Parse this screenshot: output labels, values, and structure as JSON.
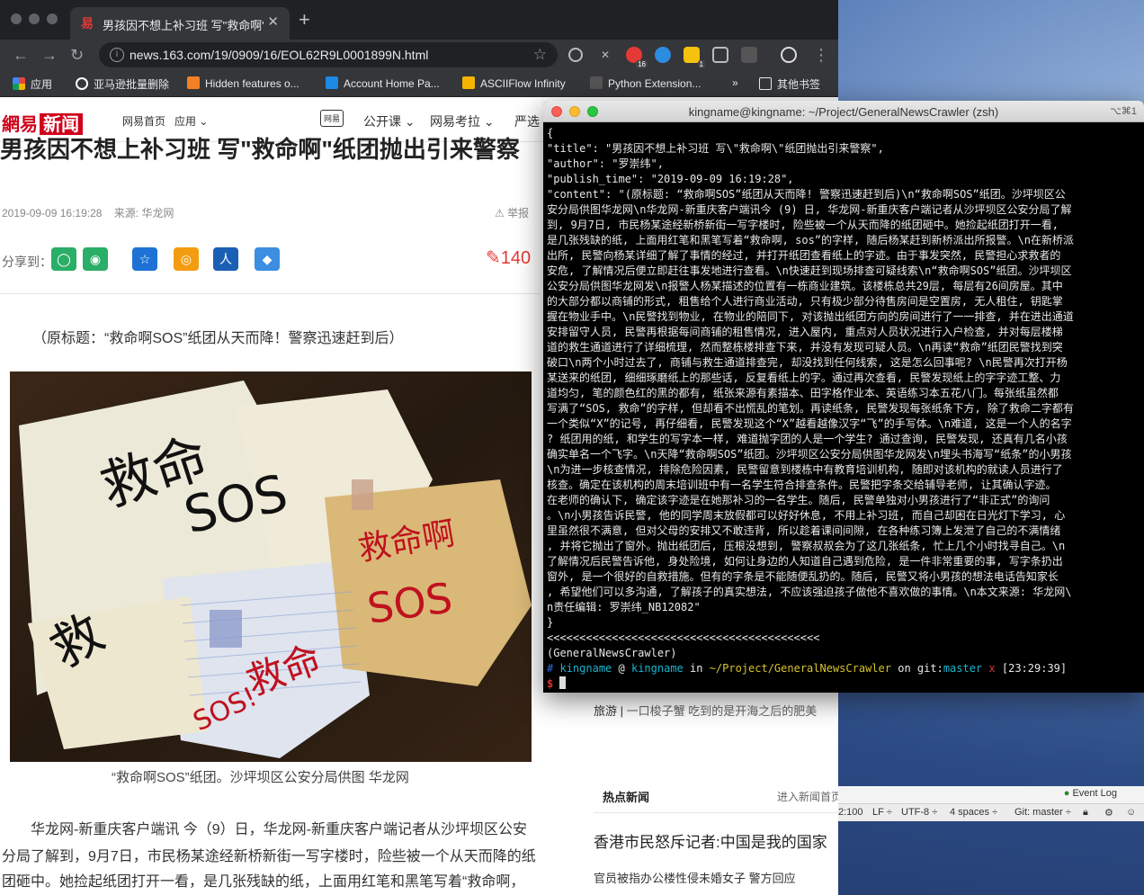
{
  "browser": {
    "tab_title": "男孩因不想上补习班 写\"救命啊\"...",
    "tab_favicon": "易",
    "url": "news.163.com/19/0909/16/EOL62R9L0001899N.html",
    "extension_badges": [
      "16",
      "1"
    ],
    "bookmarks": [
      {
        "label": "应用",
        "color": "#e8453c"
      },
      {
        "label": "亚马逊批量删除",
        "color": "#ffffff"
      },
      {
        "label": "Hidden features o...",
        "color": "#f48024"
      },
      {
        "label": "Account Home Pa...",
        "color": "#1e88e5"
      },
      {
        "label": "ASCIIFlow Infinity",
        "color": "#f4b400"
      },
      {
        "label": "Python Extension...",
        "color": "#555555"
      }
    ],
    "bookmarks_overflow": "»",
    "other_bookmarks": "其他书签"
  },
  "site": {
    "logo_text": "網易",
    "logo_box": "新闻",
    "nav_home": "网易首页",
    "nav_apps": "应用",
    "nav_open_course": "公开课",
    "nav_exam": "网易考拉",
    "nav_yanxuan": "严选",
    "nav_logo_small": "网易"
  },
  "article": {
    "headline": "男孩因不想上补习班 写\"救命啊\"纸团抛出引来警察",
    "datetime": "2019-09-09 16:19:28",
    "source": "来源: 华龙网",
    "report": "举报",
    "share_label": "分享到：",
    "comment_count": "140",
    "orig_title": "（原标题：“救命啊SOS”纸团从天而降！警察迅速赶到后）",
    "caption": "“救命啊SOS”纸团。沙坪坝区公安分局供图 华龙网",
    "body_lines": [
      "　　华龙网-新重庆客户端讯 今（9）日，华龙网-新重庆客户端记者从沙坪坝区公安",
      "分局了解到，9月7日，市民杨某途经新桥新街一写字楼时，险些被一个从天而降的纸",
      "团砸中。她捡起纸团打开一看，是几张残缺的纸，上面用红笔和黑笔写着“救命啊，"
    ]
  },
  "sidebar": {
    "travel_tag": "旅游",
    "travel_text": "一口梭子蟹 吃到的是开海之后的肥美",
    "hot_title": "热点新闻",
    "hot_more": "进入新闻首页",
    "hot_1": "香港市民怒斥记者:中国是我的国家",
    "hot_2": "官员被指办公楼性侵未婚女子 警方回应"
  },
  "editor_status": {
    "event_log": "Event Log",
    "position": "2:100",
    "line_ending": "LF ÷",
    "encoding": "UTF-8 ÷",
    "indent": "4 spaces ÷",
    "git": "Git: master ÷"
  },
  "terminal": {
    "title": "kingname@kingname: ~/Project/GeneralNewsCrawler (zsh)",
    "shortcut": "⌥⌘1",
    "output_lines": [
      "{",
      "  \"title\": \"男孩因不想上补习班 写\\\"救命啊\\\"纸团抛出引来警察\",",
      "  \"author\": \"罗崇纬\",",
      "  \"publish_time\": \"2019-09-09 16:19:28\",",
      "  \"content\": \"(原标题: “救命啊SOS”纸团从天而降! 警察迅速赶到后)\\n“救命啊SOS”纸团。沙坪坝区公",
      "安分局供图华龙网\\n华龙网-新重庆客户端讯今 (9) 日, 华龙网-新重庆客户端记者从沙坪坝区公安分局了解",
      "到, 9月7日, 市民杨某途经新桥新街一写字楼时, 险些被一个从天而降的纸团砸中。她捡起纸团打开一看,",
      "是几张残缺的纸, 上面用红笔和黑笔写着“救命啊, sos”的字样, 随后杨某赶到新桥派出所报警。\\n在新桥派",
      "出所, 民警向杨某详细了解了事情的经过, 并打开纸团查看纸上的字迹。由于事发突然, 民警担心求救者的",
      "安危, 了解情况后便立即赶往事发地进行查看。\\n快速赶到现场排查可疑线索\\n“救命啊SOS”纸团。沙坪坝区",
      "公安分局供图华龙网发\\n报警人杨某描述的位置有一栋商业建筑。该楼栋总共29层, 每层有26间房屋。其中",
      "的大部分都以商铺的形式, 租售给个人进行商业活动, 只有极少部分待售房间是空置房, 无人租住, 钥匙掌",
      "握在物业手中。\\n民警找到物业, 在物业的陪同下, 对该抛出纸团方向的房间进行了一一排查, 并在进出通道",
      "安排留守人员, 民警再根据每间商铺的租售情况, 进入屋内, 重点对人员状况进行入户检查, 并对每层楼梯",
      "道的救生通道进行了详细梳理, 然而整栋楼排查下来, 并没有发现可疑人员。\\n再读“救命”纸团民警找到突",
      "破口\\n两个小时过去了, 商铺与救生通道排查完, 却没找到任何线索, 这是怎么回事呢? \\n民警再次打开杨",
      "某送来的纸团, 细细琢磨纸上的那些话, 反复看纸上的字。通过再次查看, 民警发现纸上的字字迹工整、力",
      "道均匀, 笔的颜色红的黑的都有, 纸张来源有素描本、田字格作业本、英语练习本五花八门。每张纸虽然都",
      "写满了“SOS, 救命”的字样, 但却看不出慌乱的笔划。再读纸条, 民警发现每张纸条下方, 除了救命二字都有",
      "一个类似“X”的记号, 再仔细看, 民警发现这个“X”越看越像汉字“飞”的手写体。\\n难道, 这是一个人的名字",
      "? 纸团用的纸, 和学生的写字本一样, 难道抛字团的人是一个学生? 通过查询, 民警发现, 还真有几名小孩",
      "确实单名一个飞字。\\n天降“救命啊SOS”纸团。沙坪坝区公安分局供图华龙网发\\n埋头书海写“纸条”的小男孩",
      "\\n为进一步核查情况, 排除危险因素, 民警留意到楼栋中有教育培训机构, 随即对该机构的就读人员进行了",
      "核查。确定在该机构的周末培训班中有一名学生符合排查条件。民警把字条交给辅导老师, 让其确认字迹。",
      "在老师的确认下, 确定该字迹是在她那补习的一名学生。随后, 民警单独对小男孩进行了“非正式”的询问",
      "。\\n小男孩告诉民警, 他的同学周末放假都可以好好休息, 不用上补习班, 而自己却困在日光灯下学习, 心",
      "里虽然很不满意, 但对父母的安排又不敢违背, 所以趁着课间间隙, 在各种练习簿上发泄了自己的不满情绪",
      ", 并将它抛出了窗外。抛出纸团后, 压根没想到, 警察叔叔会为了这几张纸条, 忙上几个小时找寻自己。\\n",
      "了解情况后民警告诉他, 身处险境, 如何让身边的人知道自己遇到危险, 是一件非常重要的事, 写字条扔出",
      "窗外, 是一个很好的自救措施。但有的字条是不能随便乱扔的。随后, 民警又将小男孩的想法电话告知家长",
      ", 希望他们可以多沟通, 了解孩子的真实想法, 不应该强迫孩子做他不喜欢做的事情。\\n本文来源: 华龙网\\",
      "n责任编辑: 罗崇纬_NB12082\"",
      "}",
      "<<<<<<<<<<<<<<<<<<<<<<<<<<<<<<<<<<<<<<<<<<",
      "(GeneralNewsCrawler)"
    ],
    "prompt": {
      "hash": "#",
      "user": "kingname",
      "at": "@",
      "host": "kingname",
      "in": "in",
      "path": "~/Project/GeneralNewsCrawler",
      "on": "on",
      "git": "git:",
      "branch": "master",
      "dirty": "x",
      "time": "[23:29:39]",
      "dollar": "$"
    }
  },
  "colors": {
    "netease_red": "#d0021b",
    "share_colors": [
      "#2bae67",
      "#2bae67",
      "#1e72d6",
      "#f39c12",
      "#1a5fb4",
      "#3b8ee0"
    ]
  }
}
